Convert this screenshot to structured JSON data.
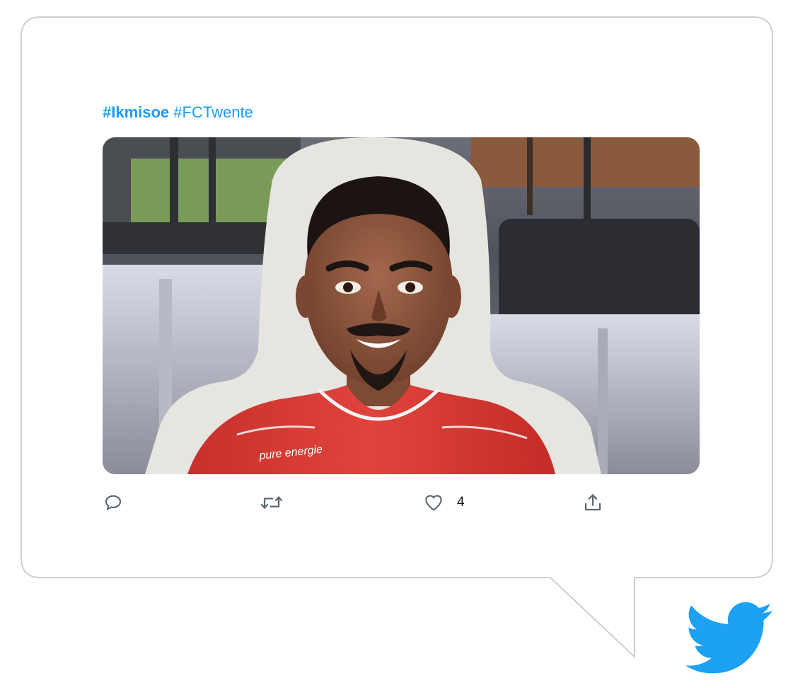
{
  "tweet": {
    "hashtags": [
      {
        "text": "#Ikmisoe",
        "bold": true
      },
      {
        "text": "#FCTwente",
        "bold": false
      }
    ],
    "image": {
      "shirt_text": "pure energie"
    },
    "actions": {
      "reply_icon": "reply-icon",
      "retweet_icon": "retweet-icon",
      "like_icon": "heart-icon",
      "like_count": "4",
      "share_icon": "share-icon"
    }
  },
  "colors": {
    "accent": "#1d9bf0",
    "bird": "#1da1f2",
    "bubble_border": "#cfcfcf",
    "icon": "#5b6670",
    "shirt": "#d93b35"
  },
  "logo": {
    "icon": "twitter-bird-icon"
  }
}
